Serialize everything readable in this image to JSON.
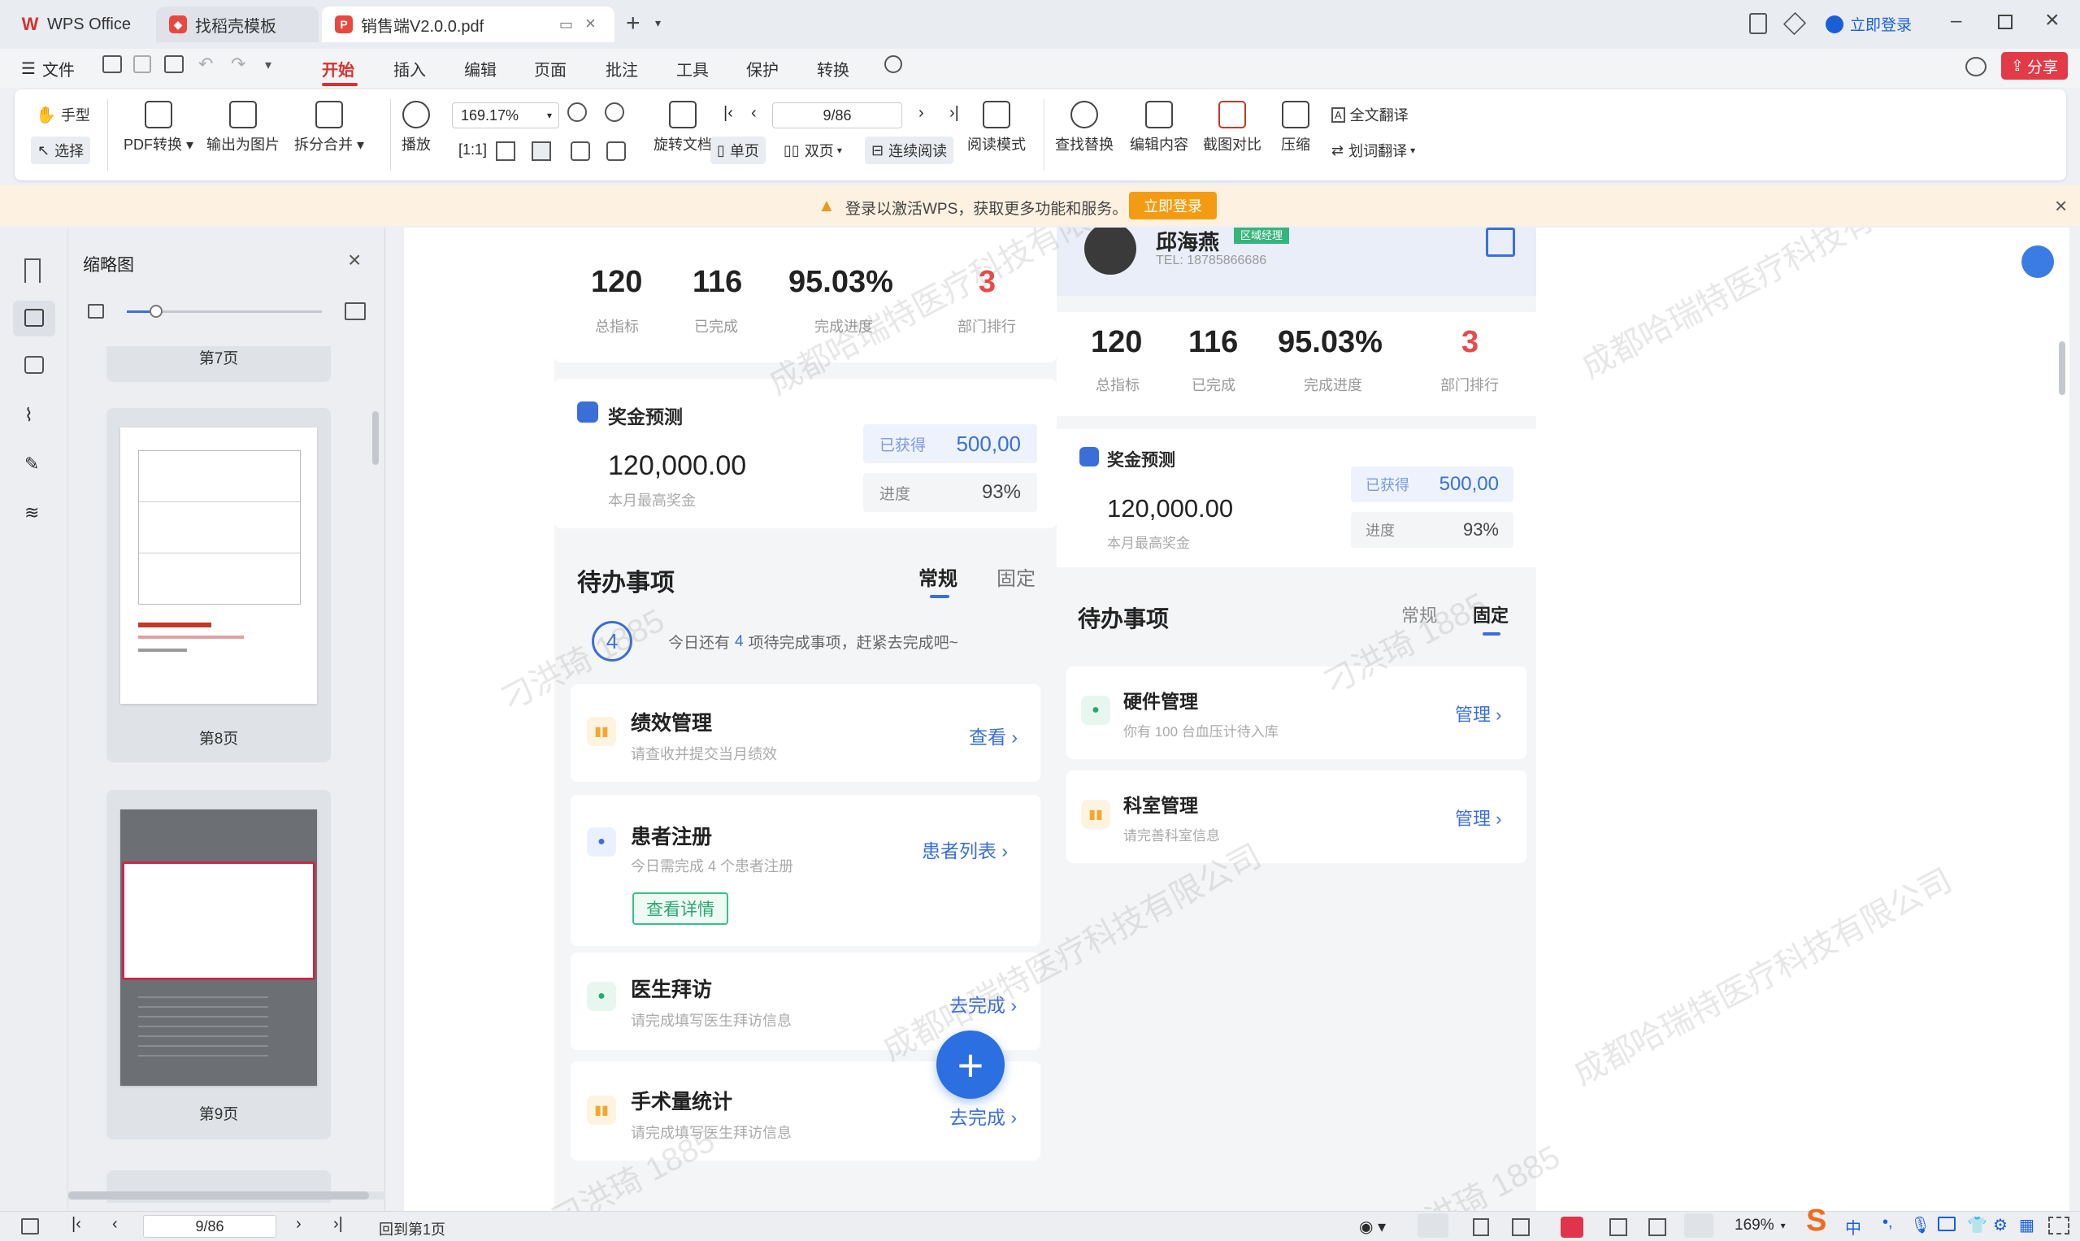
{
  "titlebar": {
    "tabs": [
      {
        "label": "WPS Office"
      },
      {
        "label": "找稻壳模板"
      },
      {
        "label": "销售端V2.0.0.pdf"
      }
    ],
    "login_label": "立即登录"
  },
  "menubar": {
    "file_label": "文件",
    "items": [
      "开始",
      "插入",
      "编辑",
      "页面",
      "批注",
      "工具",
      "保护",
      "转换"
    ],
    "active": "开始",
    "share_label": "分享"
  },
  "ribbon": {
    "hand": "手型",
    "select": "选择",
    "pdf_convert": "PDF转换",
    "export_image": "输出为图片",
    "split_merge": "拆分合并",
    "play": "播放",
    "zoom": "169.17%",
    "page_input": "9/86",
    "rotate": "旋转文档",
    "single": "单页",
    "double": "双页",
    "continuous": "连续阅读",
    "read_mode": "阅读模式",
    "find_replace": "查找替换",
    "edit_content": "编辑内容",
    "screenshot_compare": "截图对比",
    "compress": "压缩",
    "full_translate": "全文翻译",
    "word_translate": "划词翻译"
  },
  "notice": {
    "text": "登录以激活WPS，获取更多功能和服务。",
    "button": "立即登录"
  },
  "thumbnails": {
    "title": "缩略图",
    "pages": [
      {
        "label": "第7页"
      },
      {
        "label": "第8页"
      },
      {
        "label": "第9页"
      }
    ]
  },
  "doc": {
    "left": {
      "stats": [
        {
          "value": "120",
          "label": "总指标"
        },
        {
          "value": "116",
          "label": "已完成"
        },
        {
          "value": "95.03%",
          "label": "完成进度"
        },
        {
          "value": "3",
          "label": "部门排行"
        }
      ],
      "bonus": {
        "title": "奖金预测",
        "amount": "120,000.00",
        "amount_label": "本月最高奖金",
        "got_label": "已获得",
        "got_value": "500,00",
        "progress_label": "进度",
        "progress_value": "93%"
      },
      "todo": {
        "title": "待办事项",
        "tab_normal": "常规",
        "tab_fixed": "固定",
        "count": "4",
        "summary_pre": "今日还有",
        "summary_count": "4",
        "summary_post": "项待完成事项，赶紧去完成吧~",
        "tasks": [
          {
            "title": "绩效管理",
            "sub": "请查收并提交当月绩效",
            "link": "查看"
          },
          {
            "title": "患者注册",
            "sub": "今日需完成 4 个患者注册",
            "link": "患者列表",
            "button": "查看详情"
          },
          {
            "title": "医生拜访",
            "sub": "请完成填写医生拜访信息",
            "link": "去完成"
          },
          {
            "title": "手术量统计",
            "sub": "请完成填写医生拜访信息",
            "link": "去完成"
          }
        ]
      }
    },
    "right": {
      "profile_name": "邱海燕",
      "profile_tag": "区域经理",
      "profile_tel": "TEL: 18785866686",
      "stats": [
        {
          "value": "120",
          "label": "总指标"
        },
        {
          "value": "116",
          "label": "已完成"
        },
        {
          "value": "95.03%",
          "label": "完成进度"
        },
        {
          "value": "3",
          "label": "部门排行"
        }
      ],
      "bonus": {
        "title": "奖金预测",
        "amount": "120,000.00",
        "amount_label": "本月最高奖金",
        "got_label": "已获得",
        "got_value": "500,00",
        "progress_label": "进度",
        "progress_value": "93%"
      },
      "todo": {
        "title": "待办事项",
        "tab_normal": "常规",
        "tab_fixed": "固定",
        "tasks": [
          {
            "title": "硬件管理",
            "sub": "你有 100 台血压计待入库",
            "link": "管理"
          },
          {
            "title": "科室管理",
            "sub": "请完善科室信息",
            "link": "管理"
          }
        ]
      }
    },
    "watermarks": [
      "成都哈瑞特医疗科技有限公司",
      "刁洪琦 1885"
    ]
  },
  "statusbar": {
    "page_input": "9/86",
    "back_first": "回到第1页",
    "zoom": "169%"
  },
  "colors": {
    "accent_red": "#d6322f",
    "link_blue": "#3b6fd8",
    "login_blue": "#1a5fd8",
    "notice_orange": "#f39c12"
  }
}
